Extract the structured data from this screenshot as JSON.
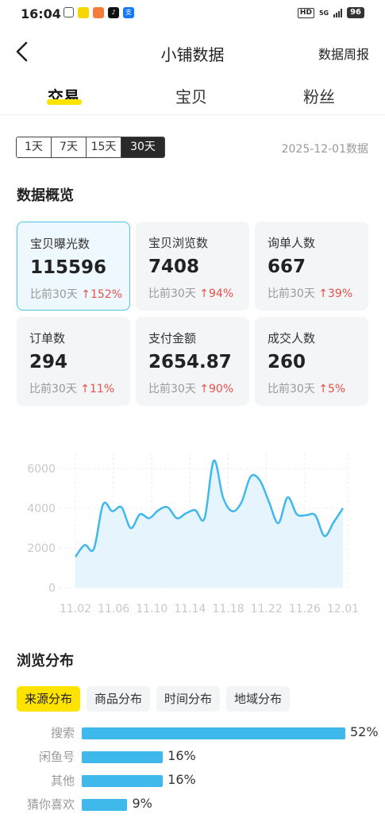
{
  "status": {
    "time": "16:04",
    "battery": "96",
    "net": "5G"
  },
  "nav": {
    "title": "小铺数据",
    "right": "数据周报"
  },
  "tabs": [
    {
      "label": "交易"
    },
    {
      "label": "宝贝"
    },
    {
      "label": "粉丝"
    }
  ],
  "ranges": [
    "1天",
    "7天",
    "15天",
    "30天"
  ],
  "selected_range": "30天",
  "date_label": "2025-12-01数据",
  "overview_title": "数据概览",
  "metrics": [
    {
      "label": "宝贝曝光数",
      "value": "115596",
      "cmp": "比前30天",
      "change": "↑152%"
    },
    {
      "label": "宝贝浏览数",
      "value": "7408",
      "cmp": "比前30天",
      "change": "↑94%"
    },
    {
      "label": "询单人数",
      "value": "667",
      "cmp": "比前30天",
      "change": "↑39%"
    },
    {
      "label": "订单数",
      "value": "294",
      "cmp": "比前30天",
      "change": "↑11%"
    },
    {
      "label": "支付金额",
      "value": "2654.87",
      "cmp": "比前30天",
      "change": "↑90%"
    },
    {
      "label": "成交人数",
      "value": "260",
      "cmp": "比前30天",
      "change": "↑5%"
    }
  ],
  "chart_data": {
    "type": "area",
    "x_ticks": [
      "11.02",
      "11.06",
      "11.10",
      "11.14",
      "11.18",
      "11.22",
      "11.26",
      "12.01"
    ],
    "y_ticks": [
      "0",
      "2000",
      "4000",
      "6000"
    ],
    "ylim": [
      0,
      6800
    ],
    "grid": true,
    "x": [
      "11.02",
      "11.03",
      "11.04",
      "11.05",
      "11.06",
      "11.07",
      "11.08",
      "11.09",
      "11.10",
      "11.11",
      "11.12",
      "11.13",
      "11.14",
      "11.15",
      "11.16",
      "11.17",
      "11.18",
      "11.19",
      "11.20",
      "11.21",
      "11.22",
      "11.23",
      "11.24",
      "11.25",
      "11.26",
      "11.27",
      "11.28",
      "11.29",
      "11.30",
      "12.01"
    ],
    "values": [
      1550,
      2150,
      1950,
      4200,
      3850,
      4050,
      3000,
      3700,
      3500,
      3900,
      4050,
      3500,
      3750,
      3900,
      3500,
      6400,
      4550,
      3850,
      4300,
      5600,
      5400,
      4300,
      3250,
      4550,
      3700,
      3650,
      3650,
      2600,
      3300,
      4000
    ],
    "color": "#3fb8ec"
  },
  "browse_title": "浏览分布",
  "dist_tabs": [
    "来源分布",
    "商品分布",
    "时间分布",
    "地域分布"
  ],
  "selected_dist_tab": "来源分布",
  "distribution": [
    {
      "label": "搜索",
      "value": 52,
      "pct": "52%"
    },
    {
      "label": "闲鱼号",
      "value": 16,
      "pct": "16%"
    },
    {
      "label": "其他",
      "value": 16,
      "pct": "16%"
    },
    {
      "label": "猜你喜欢",
      "value": 9,
      "pct": "9%"
    }
  ],
  "colors": {
    "accent": "#FFE300",
    "chart": "#3fb8ec",
    "up": "#e8504a"
  }
}
